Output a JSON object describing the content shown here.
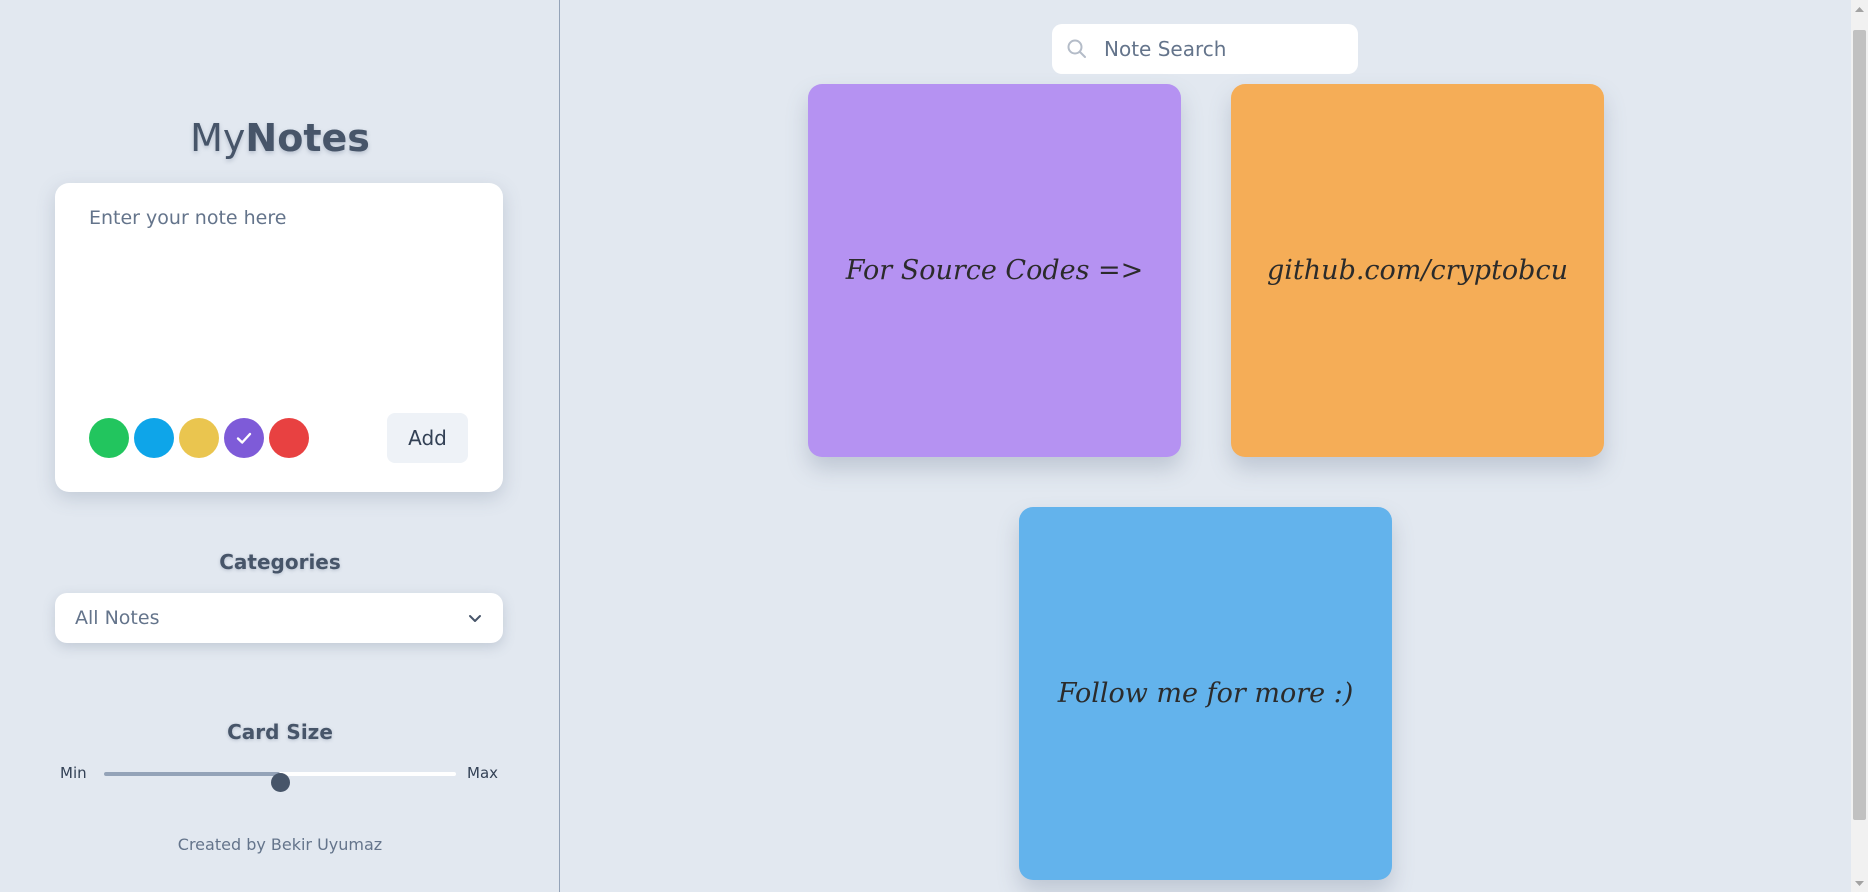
{
  "app": {
    "brand_light": "My",
    "brand_bold": "Notes"
  },
  "composer": {
    "placeholder": "Enter your note here",
    "add_label": "Add",
    "colors": [
      {
        "name": "green",
        "hex": "#22c55e",
        "selected": false
      },
      {
        "name": "blue",
        "hex": "#0ea5e9",
        "selected": false
      },
      {
        "name": "yellow",
        "hex": "#eac54f",
        "selected": false
      },
      {
        "name": "purple",
        "hex": "#7e5bd8",
        "selected": true
      },
      {
        "name": "red",
        "hex": "#e84141",
        "selected": false
      }
    ]
  },
  "categories": {
    "title": "Categories",
    "selected": "All Notes"
  },
  "card_size": {
    "title": "Card Size",
    "min_label": "Min",
    "max_label": "Max",
    "value_fraction": 0.5
  },
  "footer": {
    "credit": "Created by Bekir Uyumaz"
  },
  "search": {
    "placeholder": "Note Search"
  },
  "notes": [
    {
      "text": "For Source Codes =>",
      "color": "#b592f2"
    },
    {
      "text": "github.com/cryptobcu",
      "color": "#f5ad57"
    },
    {
      "text": "Follow me for more :)",
      "color": "#63b3ec"
    }
  ]
}
